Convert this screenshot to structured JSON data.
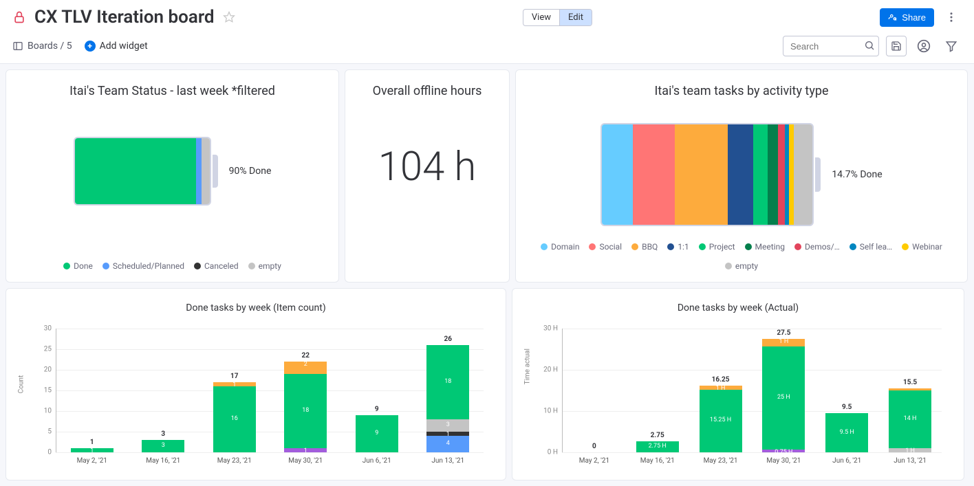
{
  "header": {
    "title": "CX TLV Iteration board",
    "view_label": "View",
    "edit_label": "Edit",
    "share_label": "Share"
  },
  "subbar": {
    "boards_label": "Boards / 5",
    "add_widget_label": "Add widget",
    "search_placeholder": "Search"
  },
  "widget1": {
    "title": "Itai's Team Status - last week *filtered",
    "pct_label": "90% Done",
    "legend": [
      {
        "label": "Done",
        "color": "#00c875"
      },
      {
        "label": "Scheduled/Planned",
        "color": "#579bfc"
      },
      {
        "label": "Canceled",
        "color": "#333333"
      },
      {
        "label": "empty",
        "color": "#c4c4c4"
      }
    ]
  },
  "widget2": {
    "title": "Overall offline hours",
    "value": "104 h"
  },
  "widget3": {
    "title": "Itai's team tasks by activity type",
    "pct_label": "14.7% Done",
    "legend": [
      {
        "label": "Domain",
        "color": "#66ccff"
      },
      {
        "label": "Social",
        "color": "#ff7575"
      },
      {
        "label": "BBQ",
        "color": "#fdab3d"
      },
      {
        "label": "1:1",
        "color": "#225091"
      },
      {
        "label": "Project",
        "color": "#00c875"
      },
      {
        "label": "Meeting",
        "color": "#037f4c"
      },
      {
        "label": "Demos/…",
        "color": "#e2445c"
      },
      {
        "label": "Self lea…",
        "color": "#0086c0"
      },
      {
        "label": "Webinar",
        "color": "#ffcb00"
      },
      {
        "label": "empty",
        "color": "#c4c4c4"
      }
    ]
  },
  "widget4": {
    "title": "Done tasks by week (Item count)"
  },
  "widget5": {
    "title": "Done tasks by week (Actual)"
  },
  "chart_data": [
    {
      "id": "team_status_battery",
      "type": "bar",
      "pct_done": 90,
      "segments": [
        {
          "name": "Done",
          "value": 90,
          "color": "#00c875"
        },
        {
          "name": "Scheduled/Planned",
          "value": 4,
          "color": "#579bfc"
        },
        {
          "name": "empty",
          "value": 6,
          "color": "#c4c4c4"
        }
      ]
    },
    {
      "id": "activity_type_battery",
      "type": "bar",
      "pct_done": 14.7,
      "segments": [
        {
          "name": "Domain",
          "value": 14.7,
          "color": "#66ccff"
        },
        {
          "name": "Social",
          "value": 20,
          "color": "#ff7575"
        },
        {
          "name": "BBQ",
          "value": 25,
          "color": "#fdab3d"
        },
        {
          "name": "1:1",
          "value": 12,
          "color": "#225091"
        },
        {
          "name": "Project",
          "value": 7,
          "color": "#00c875"
        },
        {
          "name": "Meeting",
          "value": 5,
          "color": "#037f4c"
        },
        {
          "name": "Demos/…",
          "value": 3,
          "color": "#e2445c"
        },
        {
          "name": "Self lea…",
          "value": 2,
          "color": "#0086c0"
        },
        {
          "name": "Webinar",
          "value": 2.5,
          "color": "#ffcb00"
        },
        {
          "name": "empty",
          "value": 8.8,
          "color": "#c4c4c4"
        }
      ]
    },
    {
      "id": "done_by_week_count",
      "type": "bar",
      "ylabel": "Count",
      "ylim": [
        0,
        30
      ],
      "ticks": [
        0,
        5,
        10,
        15,
        20,
        25,
        30
      ],
      "categories": [
        "May 2, '21",
        "May 16, '21",
        "May 23, '21",
        "May 30, '21",
        "Jun 6, '21",
        "Jun 13, '21"
      ],
      "totals": [
        1,
        3,
        17,
        22,
        9,
        26
      ],
      "series_colors": {
        "Done": "#00c875",
        "BBQ": "#fdab3d",
        "Purple": "#a25ddc",
        "Blue": "#579bfc",
        "Black": "#333333",
        "Grey": "#c4c4c4"
      },
      "stacks": [
        [
          {
            "name": "Done",
            "value": 1,
            "label": "1"
          }
        ],
        [
          {
            "name": "Done",
            "value": 3,
            "label": "3"
          }
        ],
        [
          {
            "name": "Done",
            "value": 16,
            "label": "16"
          },
          {
            "name": "BBQ",
            "value": 1,
            "label": "1"
          }
        ],
        [
          {
            "name": "Purple",
            "value": 1,
            "label": "1"
          },
          {
            "name": "Done",
            "value": 18,
            "label": "18"
          },
          {
            "name": "BBQ",
            "value": 1,
            "label": ""
          },
          {
            "name": "BBQ",
            "value": 2,
            "label": "2"
          }
        ],
        [
          {
            "name": "Done",
            "value": 9,
            "label": "9"
          }
        ],
        [
          {
            "name": "Blue",
            "value": 4,
            "label": "4"
          },
          {
            "name": "Black",
            "value": 1,
            "label": "1"
          },
          {
            "name": "Grey",
            "value": 3,
            "label": "3"
          },
          {
            "name": "Done",
            "value": 18,
            "label": "18"
          }
        ]
      ]
    },
    {
      "id": "done_by_week_actual",
      "type": "bar",
      "ylabel": "Time actual",
      "ylim": [
        0,
        30
      ],
      "ticks": [
        0,
        10,
        20,
        30
      ],
      "tick_suffix": " H",
      "categories": [
        "May 2, '21",
        "May 16, '21",
        "May 23, '21",
        "May 30, '21",
        "Jun 6, '21",
        "Jun 13, '21"
      ],
      "totals": [
        0,
        2.75,
        16.25,
        27.5,
        9.5,
        15.5
      ],
      "series_colors": {
        "Done": "#00c875",
        "BBQ": "#fdab3d",
        "Purple": "#a25ddc",
        "Grey": "#c4c4c4"
      },
      "stacks": [
        [],
        [
          {
            "name": "Done",
            "value": 2.75,
            "label": "2.75 H"
          }
        ],
        [
          {
            "name": "Done",
            "value": 15.25,
            "label": "15.25 H"
          },
          {
            "name": "BBQ",
            "value": 1,
            "label": "1 H"
          }
        ],
        [
          {
            "name": "Purple",
            "value": 0.75,
            "label": "0.75 H"
          },
          {
            "name": "Done",
            "value": 25,
            "label": "25 H"
          },
          {
            "name": "BBQ",
            "value": 1.75,
            "label": "1 H"
          }
        ],
        [
          {
            "name": "Done",
            "value": 9.5,
            "label": "9.5 H"
          }
        ],
        [
          {
            "name": "Grey",
            "value": 1,
            "label": "1 H"
          },
          {
            "name": "Done",
            "value": 14,
            "label": "14 H"
          },
          {
            "name": "BBQ",
            "value": 0.5,
            "label": ""
          }
        ]
      ]
    }
  ]
}
